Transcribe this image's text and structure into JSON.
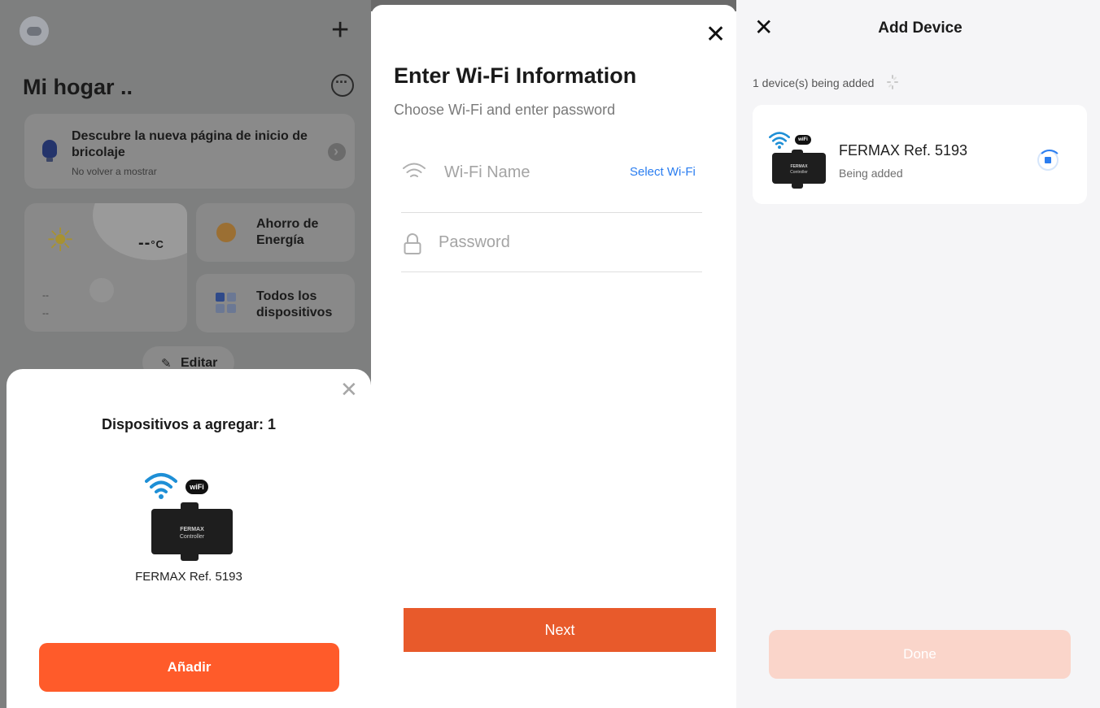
{
  "panel1": {
    "home_title": "Mi hogar ..",
    "banner_title": "Descubre la nueva página de inicio de bricolaje",
    "banner_subtitle": "No volver a mostrar",
    "temperature": "--",
    "temperature_unit": "°C",
    "weather_line1": "--",
    "weather_line2": "--",
    "card_energy": "Ahorro de Energía",
    "card_devices": "Todos los dispositivos",
    "edit_label": "Editar",
    "sheet_title": "Dispositivos a agregar: 1",
    "device_name": "FERMAX Ref. 5193",
    "device_brand": "FERMAX",
    "device_model": "Controller",
    "wifi_badge": "wiFi",
    "add_button": "Añadir",
    "accent": "#ff5b2a"
  },
  "panel2": {
    "title": "Enter Wi-Fi Information",
    "subtitle": "Choose Wi-Fi and enter password",
    "wifi_placeholder": "Wi-Fi Name",
    "select_wifi": "Select Wi-Fi",
    "password_placeholder": "Password",
    "next_button": "Next",
    "accent": "#e85a2b",
    "link_color": "#2a7df0"
  },
  "panel3": {
    "title": "Add Device",
    "count_text": "1 device(s) being added",
    "device_name": "FERMAX Ref. 5193",
    "device_status": "Being added",
    "device_brand": "FERMAX",
    "device_model": "Controller",
    "wifi_badge": "wiFi",
    "done_button": "Done",
    "done_color": "#fad5ca"
  }
}
